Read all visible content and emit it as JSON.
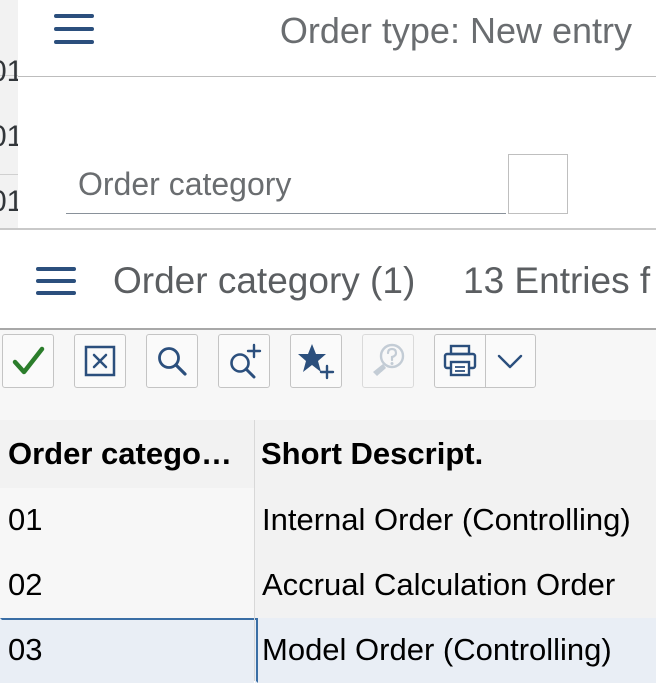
{
  "background_window": {
    "fragments": [
      "01",
      "01",
      "01"
    ]
  },
  "back_dialog": {
    "title": "Order type: New entry",
    "field_label": "Order category",
    "field_value": ""
  },
  "front_dialog": {
    "title": "Order category (1)",
    "subtitle": "13 Entries f",
    "toolbar": [
      {
        "name": "confirm",
        "icon": "check-icon"
      },
      {
        "name": "cancel",
        "icon": "close-box-icon"
      },
      {
        "name": "find",
        "icon": "search-icon"
      },
      {
        "name": "find-next",
        "icon": "search-plus-icon"
      },
      {
        "name": "add-favorite",
        "icon": "star-plus-icon"
      },
      {
        "name": "help",
        "icon": "help-icon",
        "disabled": true
      },
      {
        "name": "print",
        "icon": "printer-icon"
      },
      {
        "name": "more",
        "icon": "chevron-down-icon"
      }
    ],
    "columns": [
      "Order catego…",
      "Short Descript."
    ],
    "rows": [
      {
        "code": "01",
        "description": "Internal Order (Controlling)"
      },
      {
        "code": "02",
        "description": "Accrual Calculation Order"
      },
      {
        "code": "03",
        "description": "Model Order (Controlling)"
      }
    ]
  },
  "colors": {
    "accent": "#2b4f7d",
    "check_green": "#2b7d2b",
    "selected_row": "#e9eef5"
  }
}
